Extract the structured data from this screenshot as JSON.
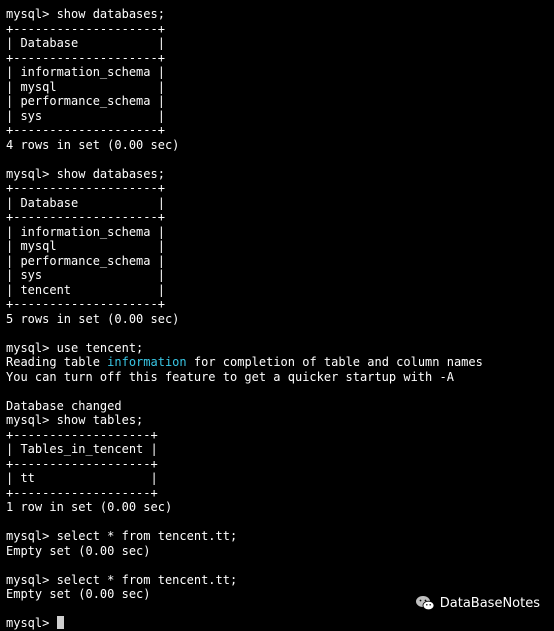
{
  "terminal": {
    "lines": [
      "mysql> show databases;",
      "+--------------------+",
      "| Database           |",
      "+--------------------+",
      "| information_schema |",
      "| mysql              |",
      "| performance_schema |",
      "| sys                |",
      "+--------------------+",
      "4 rows in set (0.00 sec)",
      "",
      "mysql> show databases;",
      "+--------------------+",
      "| Database           |",
      "+--------------------+",
      "| information_schema |",
      "| mysql              |",
      "| performance_schema |",
      "| sys                |",
      "| tencent            |",
      "+--------------------+",
      "5 rows in set (0.00 sec)",
      "",
      "mysql> use tencent;",
      {
        "pre": "Reading table ",
        "hl": "information",
        "post": " for completion of table and column names"
      },
      "You can turn off this feature to get a quicker startup with -A",
      "",
      "Database changed",
      "mysql> show tables;",
      "+-------------------+",
      "| Tables_in_tencent |",
      "+-------------------+",
      "| tt                |",
      "+-------------------+",
      "1 row in set (0.00 sec)",
      "",
      "mysql> select * from tencent.tt;",
      "Empty set (0.00 sec)",
      "",
      "mysql> select * from tencent.tt;",
      "Empty set (0.00 sec)",
      ""
    ],
    "prompt": "mysql> ",
    "highlight_color": "#39c6e4"
  },
  "watermark": {
    "icon": "wechat-icon",
    "text": "DataBaseNotes"
  }
}
